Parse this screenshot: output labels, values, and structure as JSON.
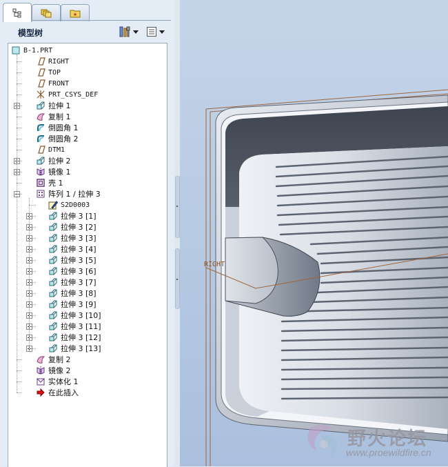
{
  "tabs": [
    {
      "name": "model-tree-tab",
      "icon": "tree-icon",
      "active": true
    },
    {
      "name": "layer-tab",
      "icon": "layers-icon",
      "active": false
    },
    {
      "name": "favorites-tab",
      "icon": "folder-star-icon",
      "active": false
    }
  ],
  "tree_header": {
    "title": "模型树",
    "settings_icon": "tools-icon",
    "show_icon": "list-icon"
  },
  "tree": [
    {
      "label": "B-1.PRT",
      "icon": "part-icon",
      "level": 0,
      "expander": "none"
    },
    {
      "label": "RIGHT",
      "icon": "datum-plane-icon",
      "level": 1,
      "expander": "none"
    },
    {
      "label": "TOP",
      "icon": "datum-plane-icon",
      "level": 1,
      "expander": "none"
    },
    {
      "label": "FRONT",
      "icon": "datum-plane-icon",
      "level": 1,
      "expander": "none"
    },
    {
      "label": "PRT_CSYS_DEF",
      "icon": "csys-icon",
      "level": 1,
      "expander": "none"
    },
    {
      "label": "拉伸 1",
      "icon": "extrude-icon",
      "level": 1,
      "expander": "plus"
    },
    {
      "label": "复制 1",
      "icon": "copy-surface-icon",
      "level": 1,
      "expander": "none"
    },
    {
      "label": "倒圆角 1",
      "icon": "round-icon",
      "level": 1,
      "expander": "none"
    },
    {
      "label": "倒圆角 2",
      "icon": "round-icon",
      "level": 1,
      "expander": "none"
    },
    {
      "label": "DTM1",
      "icon": "datum-plane-icon",
      "level": 1,
      "expander": "none"
    },
    {
      "label": "拉伸 2",
      "icon": "extrude-icon",
      "level": 1,
      "expander": "plus"
    },
    {
      "label": "镜像 1",
      "icon": "mirror-icon",
      "level": 1,
      "expander": "plus"
    },
    {
      "label": "壳 1",
      "icon": "shell-icon",
      "level": 1,
      "expander": "none"
    },
    {
      "label": "阵列 1 / 拉伸 3",
      "icon": "pattern-icon",
      "level": 1,
      "expander": "minus"
    },
    {
      "label": "S2D0003",
      "icon": "sketch-icon",
      "level": 2,
      "expander": "none"
    },
    {
      "label": "拉伸 3 [1]",
      "icon": "extrude-icon",
      "level": 2,
      "expander": "plus"
    },
    {
      "label": "拉伸 3 [2]",
      "icon": "extrude-icon",
      "level": 2,
      "expander": "plus"
    },
    {
      "label": "拉伸 3 [3]",
      "icon": "extrude-icon",
      "level": 2,
      "expander": "plus"
    },
    {
      "label": "拉伸 3 [4]",
      "icon": "extrude-icon",
      "level": 2,
      "expander": "plus"
    },
    {
      "label": "拉伸 3 [5]",
      "icon": "extrude-icon",
      "level": 2,
      "expander": "plus"
    },
    {
      "label": "拉伸 3 [6]",
      "icon": "extrude-icon",
      "level": 2,
      "expander": "plus"
    },
    {
      "label": "拉伸 3 [7]",
      "icon": "extrude-icon",
      "level": 2,
      "expander": "plus"
    },
    {
      "label": "拉伸 3 [8]",
      "icon": "extrude-icon",
      "level": 2,
      "expander": "plus"
    },
    {
      "label": "拉伸 3 [9]",
      "icon": "extrude-icon",
      "level": 2,
      "expander": "plus"
    },
    {
      "label": "拉伸 3 [10]",
      "icon": "extrude-icon",
      "level": 2,
      "expander": "plus"
    },
    {
      "label": "拉伸 3 [11]",
      "icon": "extrude-icon",
      "level": 2,
      "expander": "plus"
    },
    {
      "label": "拉伸 3 [12]",
      "icon": "extrude-icon",
      "level": 2,
      "expander": "plus"
    },
    {
      "label": "拉伸 3 [13]",
      "icon": "extrude-icon",
      "level": 2,
      "expander": "plus"
    },
    {
      "label": "复制 2",
      "icon": "copy-surface-icon",
      "level": 1,
      "expander": "none"
    },
    {
      "label": "镜像 2",
      "icon": "mirror-icon",
      "level": 1,
      "expander": "none"
    },
    {
      "label": "实体化 1",
      "icon": "solidify-icon",
      "level": 1,
      "expander": "none"
    },
    {
      "label": "在此插入",
      "icon": "insert-here-arrow-icon",
      "level": 1,
      "expander": "none"
    }
  ],
  "viewport": {
    "datum_label": "RIGHT",
    "datum_color": "#a0643a"
  },
  "watermark": {
    "title": "野火论坛",
    "url": "www.proewildfire.cn"
  }
}
